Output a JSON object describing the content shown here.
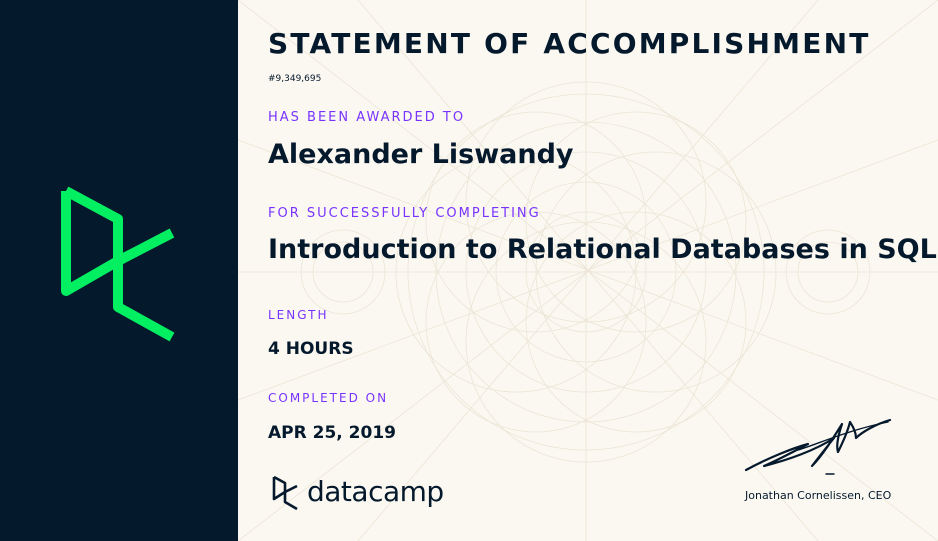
{
  "certificate": {
    "title": "STATEMENT OF ACCOMPLISHMENT",
    "id": "#9,349,695",
    "awarded_label": "HAS BEEN AWARDED TO",
    "recipient": "Alexander Liswandy",
    "completing_label": "FOR SUCCESSFULLY COMPLETING",
    "course": "Introduction to Relational Databases in SQL",
    "length_label": "LENGTH",
    "length_value": "4 HOURS",
    "completed_label": "COMPLETED ON",
    "completed_date": "APR 25, 2019"
  },
  "brand": {
    "name": "datacamp"
  },
  "signature": {
    "signer": "Jonathan Cornelissen, CEO"
  },
  "colors": {
    "sidebar": "#05192d",
    "logo_green": "#03ef62",
    "accent_purple": "#7933ff",
    "text_dark": "#05192d",
    "background": "#fbf8f1"
  }
}
